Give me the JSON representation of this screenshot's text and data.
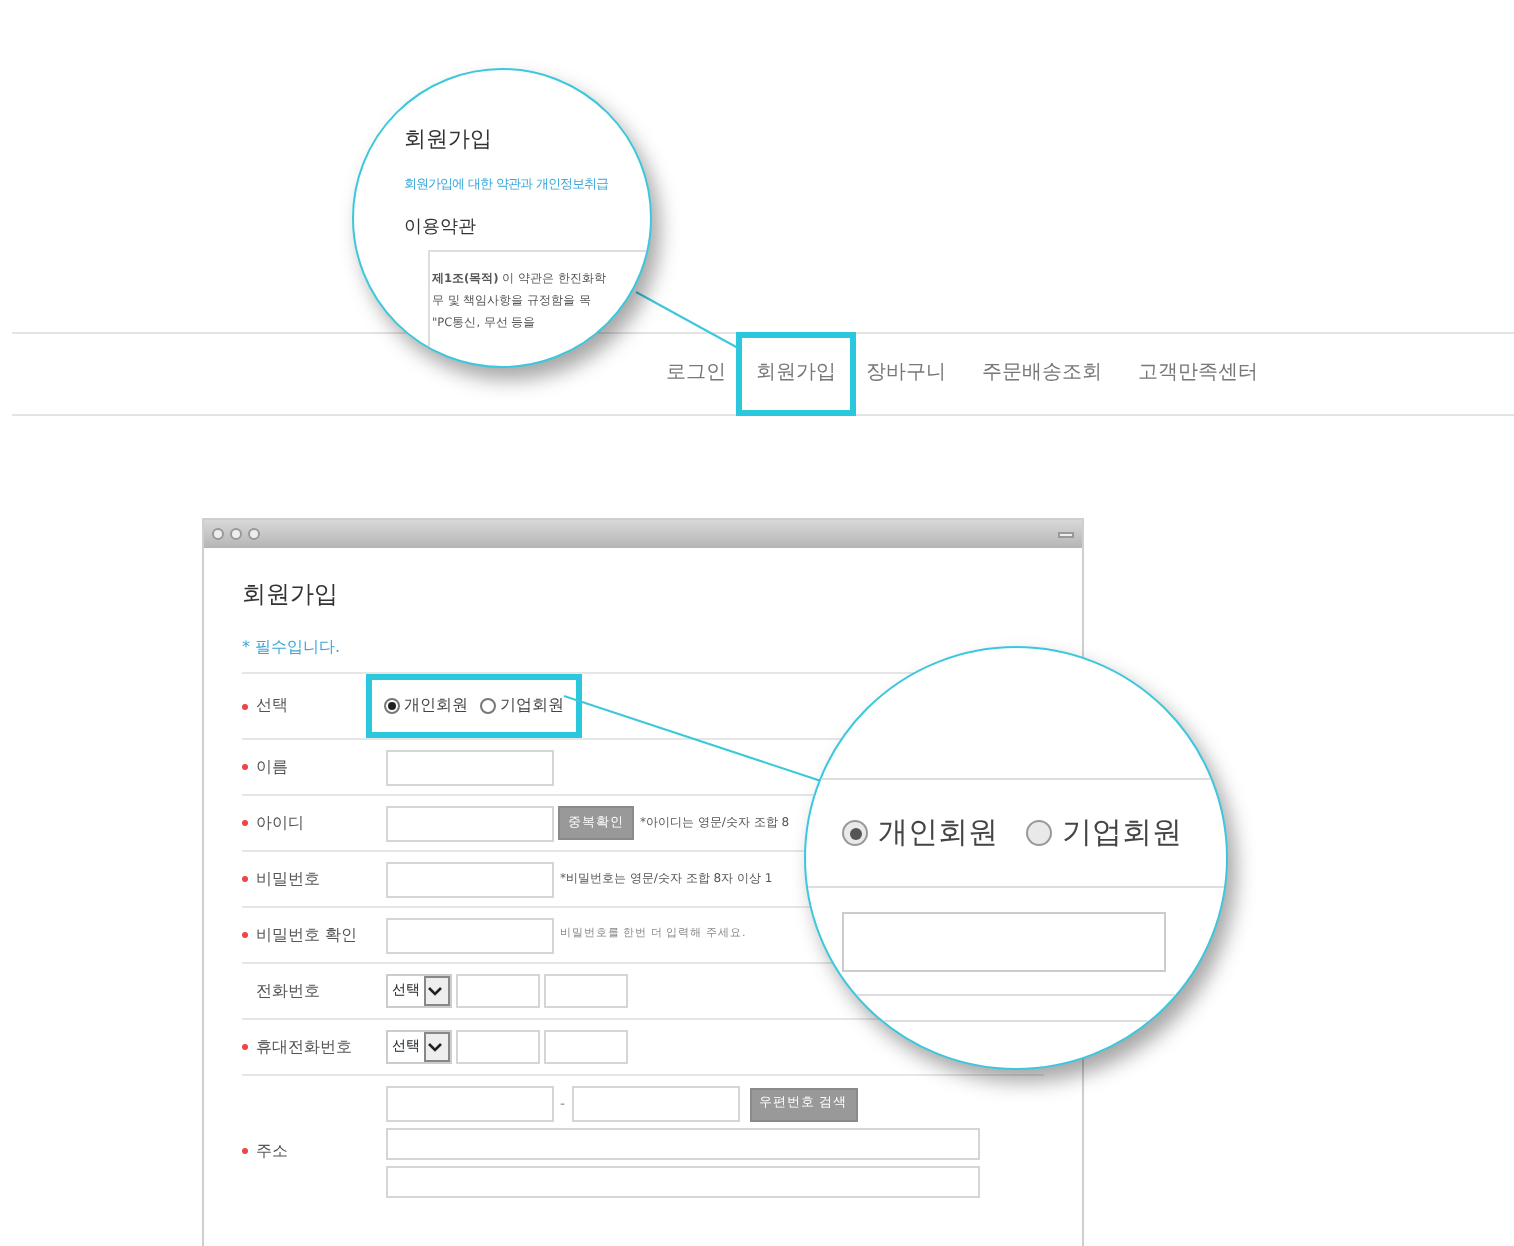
{
  "nav": [
    {
      "label": "로그인",
      "highlighted": false
    },
    {
      "label": "회원가입",
      "highlighted": true
    },
    {
      "label": "장바구니",
      "highlighted": false
    },
    {
      "label": "주문배송조회",
      "highlighted": false
    },
    {
      "label": "고객만족센터",
      "highlighted": false
    }
  ],
  "zoom_terms": {
    "title": "회원가입",
    "link": "회원가입에 대한 약관과 개인정보취급",
    "section": "이용약관",
    "lines": [
      "**제1조(목적)** 이 약관은 한진화학",
      "무 및 책임사항을 규정함을 목",
      "\"PC통신, 무선 등을"
    ]
  },
  "window": {
    "title": "회원가입",
    "required_note": "* 필수입니다.",
    "rows": [
      {
        "label": "선택",
        "required": true,
        "kind": "radio",
        "highlighted": true,
        "options": [
          {
            "label": "개인회원",
            "selected": true
          },
          {
            "label": "기업회원",
            "selected": false
          }
        ]
      },
      {
        "label": "이름",
        "required": true,
        "kind": "text"
      },
      {
        "label": "아이디",
        "required": true,
        "kind": "text",
        "button": "중복확인",
        "note": "*아이디는 영문/숫자 조합 8"
      },
      {
        "label": "비밀번호",
        "required": true,
        "kind": "text",
        "note": "*비밀번호는 영문/숫자 조합 8자 이상 1"
      },
      {
        "label": "비밀번호 확인",
        "required": true,
        "kind": "text",
        "hint": "비밀번호를 한번 더 입력해 주세요."
      },
      {
        "label": "전화번호",
        "required": false,
        "kind": "phone",
        "select": "선택"
      },
      {
        "label": "휴대전화번호",
        "required": true,
        "kind": "phone",
        "select": "선택"
      },
      {
        "label": "주소",
        "required": true,
        "kind": "address",
        "separator": "-",
        "button": "우편번호 검색"
      }
    ]
  },
  "zoom_choice": {
    "options": [
      {
        "label": "개인회원",
        "selected": true
      },
      {
        "label": "기업회원",
        "selected": false
      }
    ]
  }
}
